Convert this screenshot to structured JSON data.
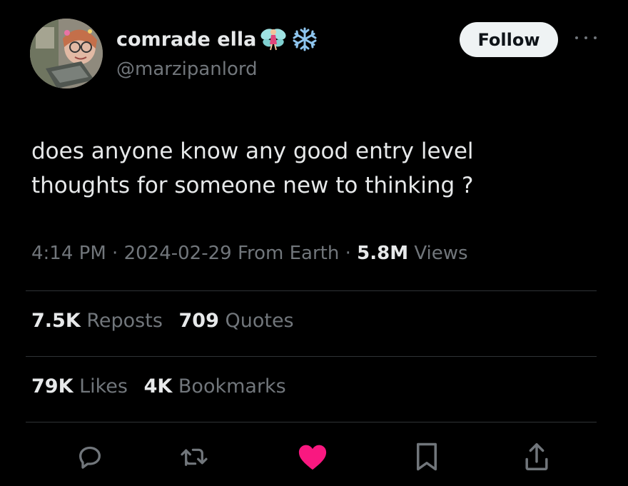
{
  "author": {
    "display_name": "comrade ella",
    "emojis": [
      "fairy-emoji",
      "snowflake-emoji"
    ],
    "handle": "@marzipanlord"
  },
  "header": {
    "follow_label": "Follow"
  },
  "tweet": {
    "text": "does anyone know any good entry level\nthoughts for someone new to thinking ?"
  },
  "meta": {
    "time": "4:14 PM",
    "separator": "·",
    "date": "2024-02-29",
    "location": "From Earth",
    "views_count": "5.8M",
    "views_label": "Views"
  },
  "stats": {
    "reposts_count": "7.5K",
    "reposts_label": "Reposts",
    "quotes_count": "709",
    "quotes_label": "Quotes",
    "likes_count": "79K",
    "likes_label": "Likes",
    "bookmarks_count": "4K",
    "bookmarks_label": "Bookmarks"
  },
  "actions": [
    "reply-icon",
    "repost-icon",
    "like-icon",
    "bookmark-icon",
    "share-icon"
  ],
  "colors": {
    "background": "#000000",
    "primary_text": "#e7e9ea",
    "secondary_text": "#71767b",
    "divider": "#2f3336",
    "like_active": "#f91880",
    "follow_bg": "#eff3f4"
  }
}
